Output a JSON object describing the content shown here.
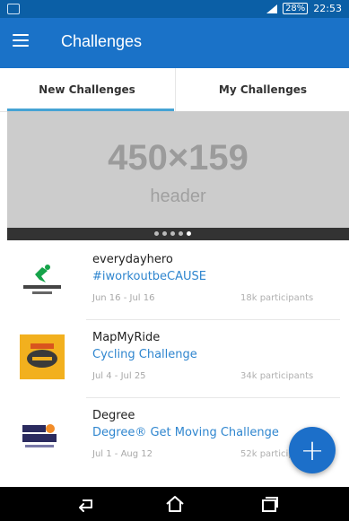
{
  "status_bar": {
    "battery": "28%",
    "time": "22:53"
  },
  "app_bar": {
    "title": "Challenges",
    "menu_icon": "hamburger-menu-icon"
  },
  "tabs": [
    {
      "label": "New Challenges",
      "active": true
    },
    {
      "label": "My Challenges",
      "active": false
    }
  ],
  "hero": {
    "size_text": "450×159",
    "caption": "header",
    "carousel_page": 5,
    "carousel_total": 5
  },
  "challenges": [
    {
      "org": "everydayhero",
      "name": "#iworkoutbeCAUSE",
      "dates": "Jun 16 - Jul 16",
      "participants": "18k participants",
      "logo": "everydayhero-logo"
    },
    {
      "org": "MapMyRide",
      "name": "Cycling Challenge",
      "dates": "Jul 4 - Jul 25",
      "participants": "34k participants",
      "logo": "mapmyride-logo"
    },
    {
      "org": "Degree",
      "name": "Degree® Get Moving Challenge",
      "dates": "Jul 1 - Aug 12",
      "participants": "52k participants",
      "logo": "degree-get-moving-logo"
    }
  ],
  "fab": {
    "label": "+",
    "icon": "plus-icon"
  },
  "nav_bar": {
    "back_icon": "back-icon",
    "home_icon": "home-icon",
    "recents_icon": "recents-icon"
  },
  "colors": {
    "status_bar": "#0b5fa6",
    "app_bar": "#1a72c8",
    "accent": "#46a3d4",
    "link": "#2f86cf",
    "fab": "#1c6fc9"
  }
}
